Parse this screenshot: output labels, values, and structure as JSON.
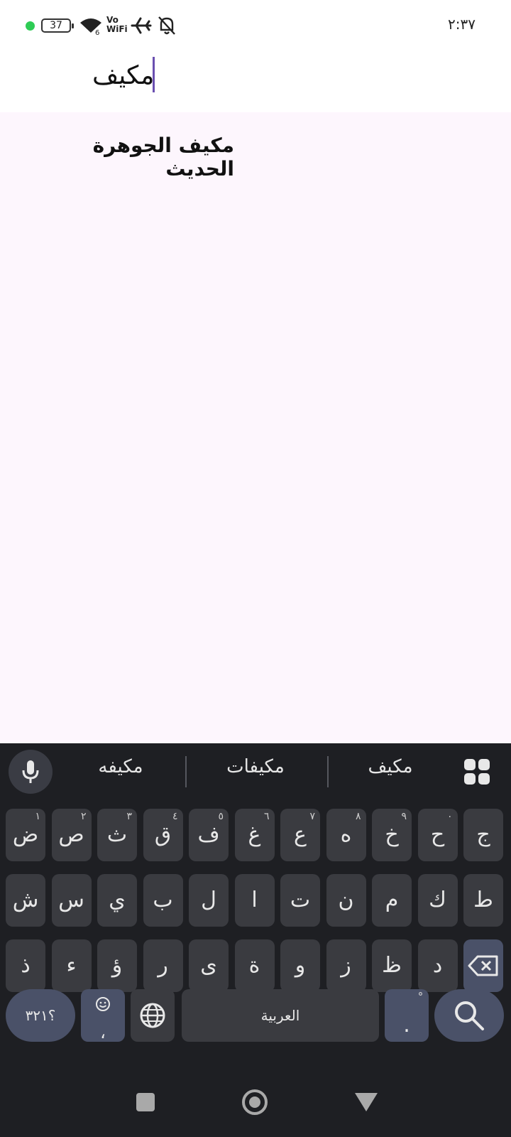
{
  "status_bar": {
    "time": "٢:٣٧",
    "battery_level": "37",
    "network_label_top": "Vo",
    "network_label_bottom": "WiFi",
    "wifi_sub": "6",
    "dot_color": "#2ecc55"
  },
  "search": {
    "query": "مكيف"
  },
  "results": [
    {
      "label": "مكيف الجوهرة الحديث"
    }
  ],
  "keyboard": {
    "suggestions": [
      "مكيفه",
      "مكيفات",
      "مكيف"
    ],
    "row1": [
      {
        "label": "ض",
        "hint": "١"
      },
      {
        "label": "ص",
        "hint": "٢"
      },
      {
        "label": "ث",
        "hint": "٣"
      },
      {
        "label": "ق",
        "hint": "٤"
      },
      {
        "label": "ف",
        "hint": "٥"
      },
      {
        "label": "غ",
        "hint": "٦"
      },
      {
        "label": "ع",
        "hint": "٧"
      },
      {
        "label": "ه",
        "hint": "٨"
      },
      {
        "label": "خ",
        "hint": "٩"
      },
      {
        "label": "ح",
        "hint": "٠"
      },
      {
        "label": "ج",
        "hint": ""
      }
    ],
    "row2": [
      "ش",
      "س",
      "ي",
      "ب",
      "ل",
      "ا",
      "ت",
      "ن",
      "م",
      "ك",
      "ط"
    ],
    "row3": [
      "ذ",
      "ء",
      "ؤ",
      "ر",
      "ى",
      "ة",
      "و",
      "ز",
      "ظ",
      "د"
    ],
    "symbols_label": "؟٣٢١",
    "comma_label": "،",
    "space_label": "العربية",
    "period_label": ".",
    "period_hint": "ْ"
  }
}
